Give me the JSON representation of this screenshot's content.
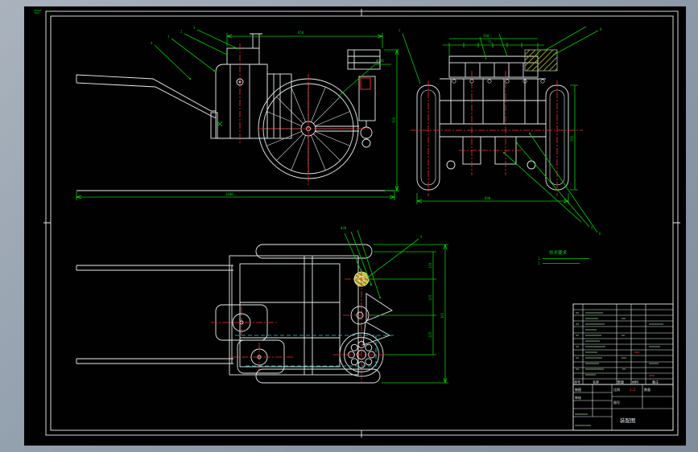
{
  "window": {
    "title": "CAD assembly drawing sheet"
  },
  "colors": {
    "desktop": "#93a0ae",
    "paper": "#010101",
    "line": "#e9eef0",
    "dimension": "#00cf00",
    "centerline": "#ff2a2a",
    "auxiliary": "#00dcdc",
    "highlight": "#cfc13a"
  },
  "notes": {
    "title": "技术要求",
    "line1": "1.",
    "line2": "2."
  },
  "labels": {
    "side_top_dim": "650",
    "side_bottom_dim": "1600",
    "side_right_dim": "705",
    "wheel_dia": "Φ600",
    "side_leader_1": "1",
    "side_leader_2": "2",
    "side_leader_3": "3",
    "side_leader_4": "4",
    "rear_top_dim": "75",
    "rear_overall_dim": "560",
    "rear_bottom_dim": "890",
    "rear_right_dim": "705",
    "rear_leader_5": "5",
    "rear_leader_6": "6",
    "rear_leader_7": "7",
    "rear_leader_8": "8",
    "plan_dim_a": "120",
    "plan_dim_b": "115",
    "plan_dim_c": "125",
    "plan_right_dim": "365",
    "plan_top_leader": "Φ30",
    "plan_leader_9": "9"
  },
  "titleblock": {
    "headers": [
      "序号",
      "名称",
      "数量",
      "材料",
      "备注"
    ],
    "fields": {
      "drawn": "制图",
      "checked": "审核",
      "scale": "比例",
      "scale_value": "1:2",
      "qty": "数量",
      "sheet": "图号",
      "title": "装配图"
    }
  }
}
